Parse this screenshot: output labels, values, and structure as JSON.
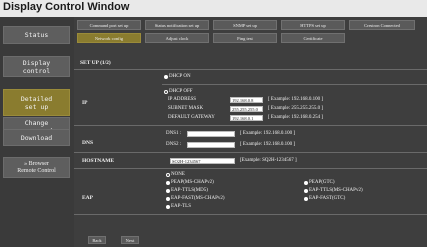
{
  "window": {
    "title": "Display Control Window"
  },
  "sidebar": {
    "status": "Status",
    "display_control": "Display\ncontrol",
    "detailed_setup": "Detailed\nset up",
    "change_password": "Change\npassword",
    "download": "Download",
    "browser_remote": "» Browser\nRemote Control"
  },
  "tabs": {
    "row1": [
      "Command port set up",
      "Status notification set up",
      "SNMP set up",
      "HTTPS set up",
      "Crestron Connected"
    ],
    "row2": [
      "Network config",
      "Adjust clock",
      "Ping test",
      "Certificate"
    ]
  },
  "form": {
    "section_title": "SET UP (1/2)",
    "ip": {
      "label": "IP",
      "dhcp_on": "DHCP ON",
      "dhcp_off": "DHCP OFF",
      "ip_address_label": "IP ADDRESS",
      "ip_address_value": "192.168.0.8",
      "ip_address_hint": "[ Example: 192.168.0.100 ]",
      "subnet_label": "SUBNET MASK",
      "subnet_value": "255.255.255.0",
      "subnet_hint": "[ Example: 255.255.255.0 ]",
      "gateway_label": "DEFAULT GATEWAY",
      "gateway_value": "192.168.0.1",
      "gateway_hint": "[ Example: 192.168.0.254 ]"
    },
    "dns": {
      "label": "DNS",
      "dns1_label": "DNS1 :",
      "dns1_value": "",
      "dns1_hint": "[ Example: 192.168.0.100 ]",
      "dns2_label": "DNS2 :",
      "dns2_value": "",
      "dns2_hint": "[ Example: 192.168.0.100 ]"
    },
    "hostname": {
      "label": "HOSTNAME",
      "value": "SQ2H-1234567",
      "hint": "[Example: SQ2H-1234567 ]"
    },
    "eap": {
      "label": "EAP",
      "options": [
        "NONE",
        "PEAP(MS-CHAPv2)",
        "PEAP(GTC)",
        "EAP-TTLS(MD5)",
        "EAP-TTLS(MS-CHAPv2)",
        "EAP-FAST(MS-CHAPv2)",
        "EAP-FAST(GTC)",
        "EAP-TLS"
      ]
    }
  },
  "nav": {
    "back": "Back",
    "next": "Next"
  }
}
